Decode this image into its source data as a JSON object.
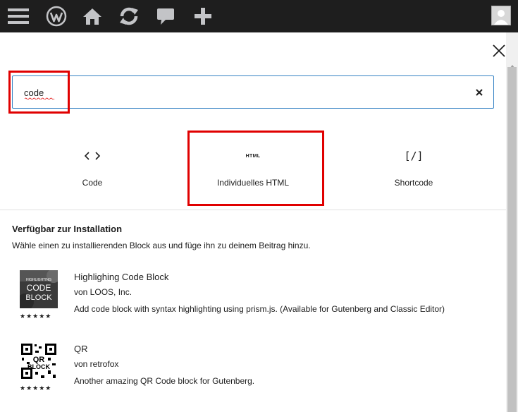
{
  "search": {
    "value": "code",
    "placeholder": ""
  },
  "blocks": [
    {
      "label": "Code",
      "icon_name": "code-icon"
    },
    {
      "label": "Individuelles HTML",
      "icon_name": "html-icon",
      "icon_text": "HTML"
    },
    {
      "label": "Shortcode",
      "icon_name": "shortcode-icon",
      "icon_text": "[/]"
    }
  ],
  "install_section": {
    "title": "Verfügbar zur Installation",
    "description": "Wähle einen zu installierenden Block aus und füge ihn zu deinem Beitrag hinzu."
  },
  "plugins": [
    {
      "name": "Highlighing Code Block",
      "author": "von LOOS, Inc.",
      "description": "Add code block with syntax highlighting using prism.js. (Available for Gutenberg and Classic Editor)",
      "stars": "★★★★★",
      "thumb_lines": [
        "HIGHLIGHTING",
        "CODE",
        "BLOCK"
      ]
    },
    {
      "name": "QR",
      "author": "von retrofox",
      "description": "Another amazing QR Code block for Gutenberg.",
      "stars": "★★★★★",
      "thumb_lines": [
        "QR",
        "BLOCK"
      ]
    }
  ],
  "colors": {
    "admin_bar": "#1e1e1e",
    "focus": "#3582c4",
    "annotation": "#e00000"
  }
}
